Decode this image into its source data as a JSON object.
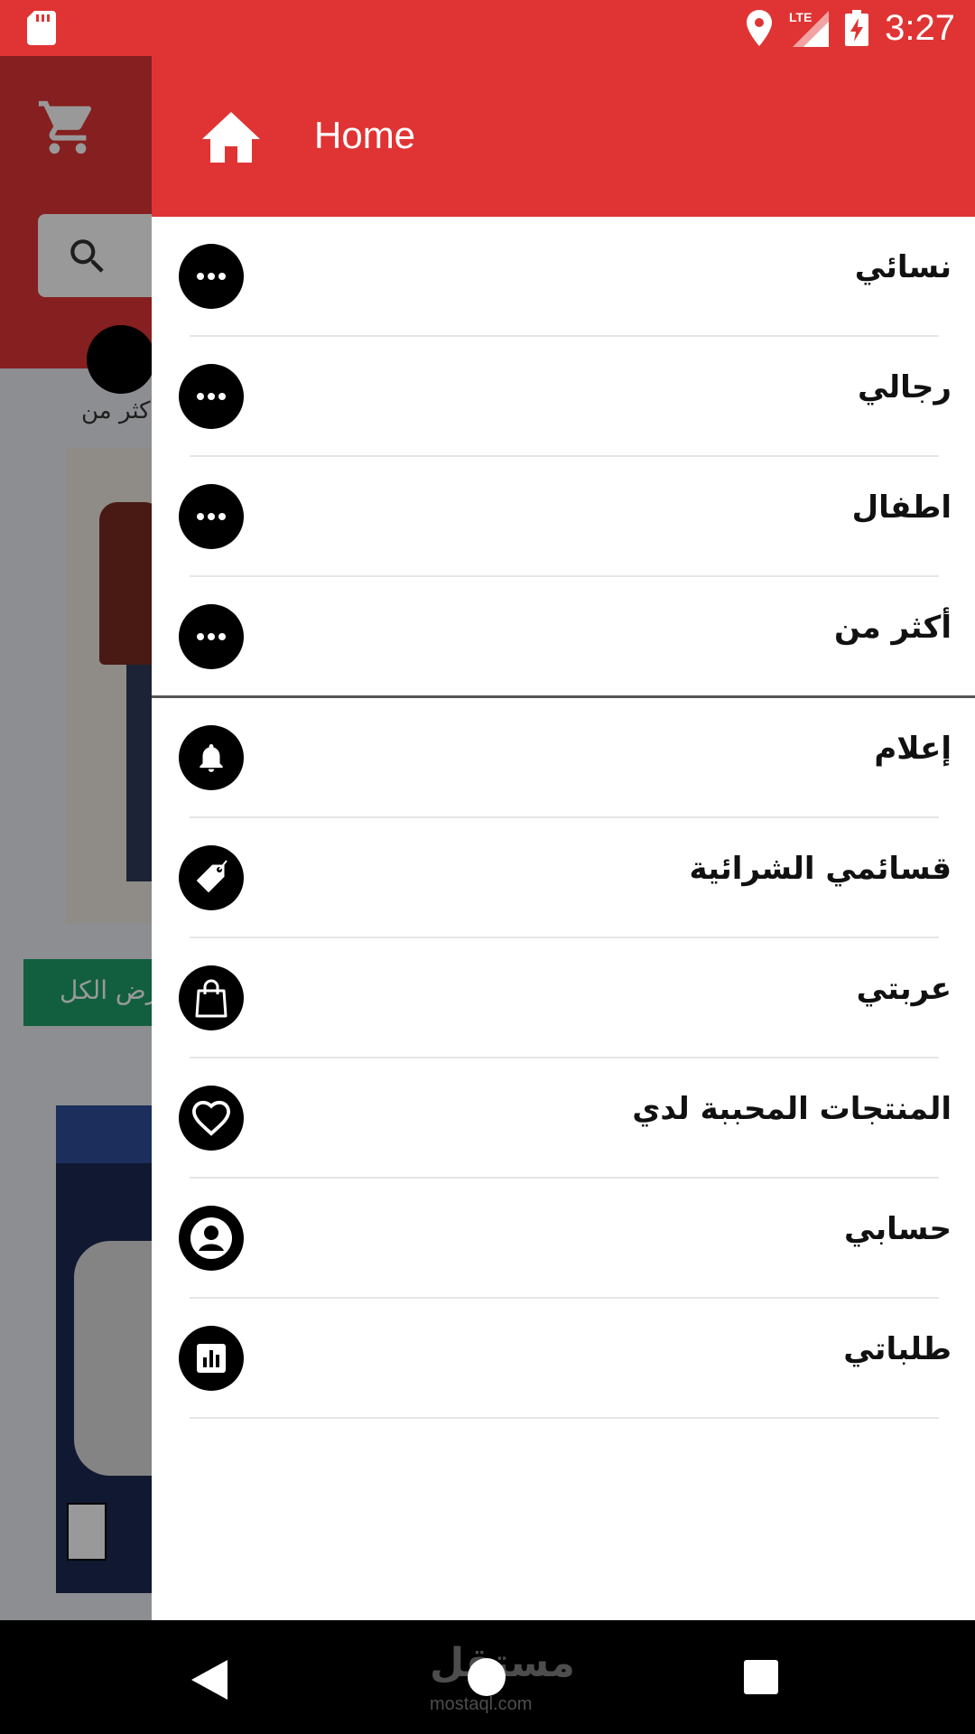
{
  "status_bar": {
    "time": "3:27",
    "network": "LTE"
  },
  "background": {
    "more_label": "أكثر من",
    "view_all_label": "عرض الكل"
  },
  "drawer": {
    "title": "Home",
    "categories": [
      {
        "label": "نسائي",
        "icon": "more-dots-icon"
      },
      {
        "label": "رجالي",
        "icon": "more-dots-icon"
      },
      {
        "label": "اطفال",
        "icon": "more-dots-icon"
      },
      {
        "label": "أكثر من",
        "icon": "more-dots-icon"
      }
    ],
    "menu": [
      {
        "label": "إعلام",
        "icon": "bell-icon"
      },
      {
        "label": "قسائمي الشرائية",
        "icon": "tag-icon"
      },
      {
        "label": "عربتي",
        "icon": "shopping-bag-icon"
      },
      {
        "label": "المنتجات المحببة لدي",
        "icon": "heart-icon"
      },
      {
        "label": "حسابي",
        "icon": "account-icon"
      },
      {
        "label": "طلباتي",
        "icon": "orders-chart-icon"
      }
    ]
  },
  "watermark": {
    "text": "مستقل",
    "sub": "mostaql.com"
  },
  "colors": {
    "primary": "#e03434",
    "accent_green": "#1e9e6a"
  }
}
